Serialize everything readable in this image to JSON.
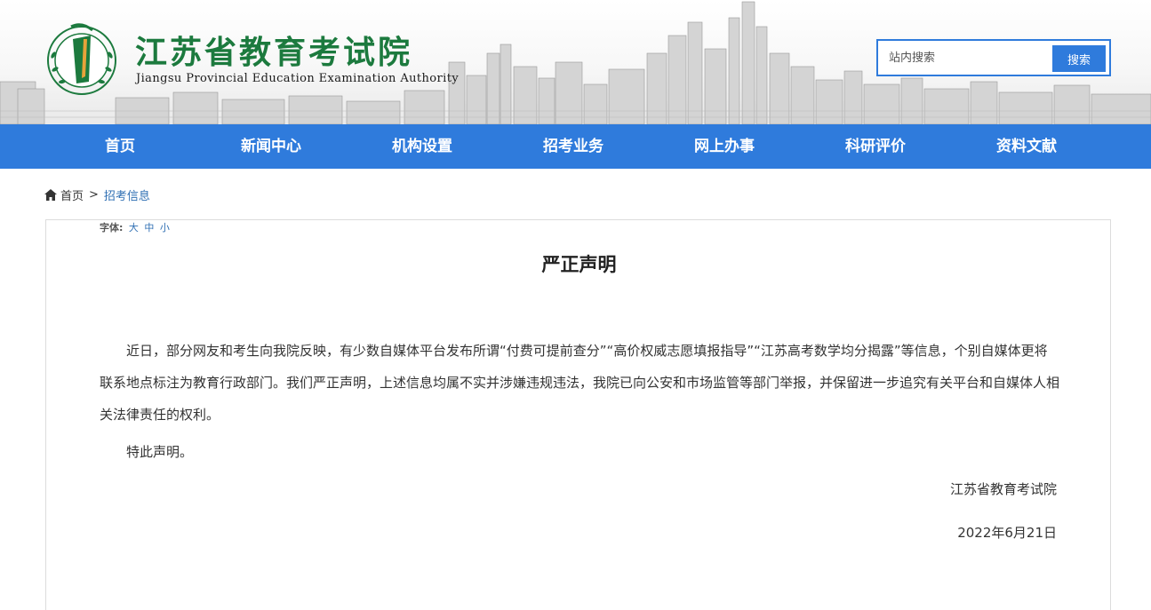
{
  "header": {
    "logo_cn": "江苏省教育考试院",
    "logo_en": "Jiangsu Provincial Education Examination Authority",
    "colors": {
      "logo_green": "#1c7a3e",
      "accent_blue": "#2f7bdc"
    }
  },
  "search": {
    "placeholder": "站内搜索",
    "button_label": "搜索"
  },
  "nav": {
    "items": [
      "首页",
      "新闻中心",
      "机构设置",
      "招考业务",
      "网上办事",
      "科研评价",
      "资料文献"
    ]
  },
  "breadcrumb": {
    "home_icon": "home-icon",
    "home": "首页",
    "separator": ">",
    "current": "招考信息"
  },
  "font_size": {
    "label": "字体:",
    "large": "大",
    "medium": "中",
    "small": "小"
  },
  "article": {
    "title": "严正声明",
    "paragraphs": [
      "近日，部分网友和考生向我院反映，有少数自媒体平台发布所谓“付费可提前查分”“高价权威志愿填报指导”“江苏高考数学均分揭露”等信息，个别自媒体更将联系地点标注为教育行政部门。我们严正声明，上述信息均属不实并涉嫌违规违法，我院已向公安和市场监管等部门举报，并保留进一步追究有关平台和自媒体人相关法律责任的权利。",
      "特此声明。"
    ],
    "signature": "江苏省教育考试院",
    "date": "2022年6月21日"
  }
}
